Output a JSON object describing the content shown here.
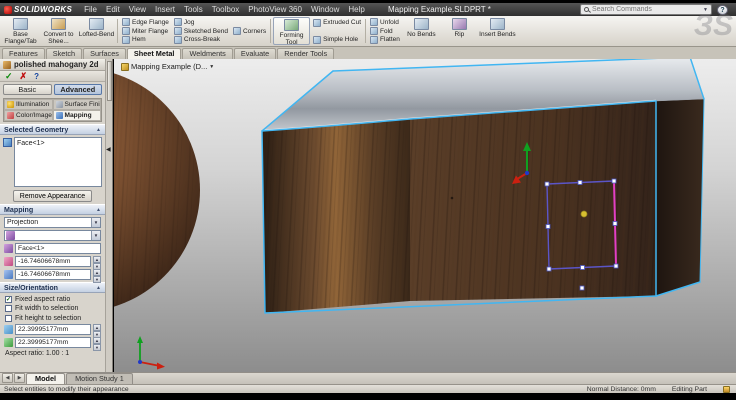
{
  "titlebar": {
    "logo_text": "SOLIDWORKS",
    "menus": [
      "File",
      "Edit",
      "View",
      "Insert",
      "Tools",
      "Toolbox",
      "PhotoView 360",
      "Window",
      "Help"
    ],
    "doc_title": "Mapping Example.SLDPRT *",
    "search_placeholder": "Search Commands"
  },
  "toolbar": {
    "large1": [
      "Base Flange/Tab",
      "Convert to Shee...",
      "Lofted-Bend"
    ],
    "col1": [
      "Edge Flange",
      "Miter Flange",
      "Hem"
    ],
    "col2": [
      "Jog",
      "Sketched Bend",
      "Cross-Break"
    ],
    "corners": "Corners",
    "forming_tool": "Forming Tool",
    "col3": [
      "Extruded Cut",
      "Simple Hole"
    ],
    "col4": [
      "Unfold",
      "Fold",
      "Flatten"
    ],
    "large2": [
      "No Bends",
      "Rip",
      "Insert Bends"
    ]
  },
  "ribbon": {
    "tabs": [
      "Features",
      "Sketch",
      "Surfaces",
      "Sheet Metal",
      "Weldments",
      "Evaluate",
      "Render Tools"
    ]
  },
  "panel": {
    "title": "polished mahogany 2d",
    "modes": [
      "Basic",
      "Advanced"
    ],
    "tabs": [
      "Illumination",
      "Surface Finish",
      "Color/Image",
      "Mapping"
    ],
    "selected_geometry": {
      "header": "Selected Geometry",
      "items": [
        "Face<1>"
      ],
      "remove_button": "Remove Appearance"
    },
    "mapping": {
      "header": "Mapping",
      "projection_type": "Projection",
      "reference": "Face<1>",
      "offset_x": "-16.74606678mm",
      "offset_y": "-16.74606678mm"
    },
    "size_orientation": {
      "header": "Size/Orientation",
      "fixed_aspect": "Fixed aspect ratio",
      "fit_width": "Fit width to selection",
      "fit_height": "Fit height to selection",
      "width": "22.39995177mm",
      "height": "22.39995177mm",
      "aspect": "Aspect ratio: 1.00 : 1"
    }
  },
  "viewport": {
    "tree_label": "Mapping Example (D..."
  },
  "bottom_tabs": {
    "tabs": [
      "Model",
      "Motion Study 1"
    ]
  },
  "statusbar": {
    "hint": "Select entities to modify their appearance",
    "normal_distance": "Normal Distance: 0mm",
    "mode": "Editing Part"
  },
  "icons": {
    "check": "✓",
    "cancel": "✗",
    "help": "?",
    "down": "▼",
    "up": "▲",
    "left": "◀",
    "right": "▶",
    "watermark": "ЗS"
  },
  "colors": {
    "edge_highlight": "#41b6f2",
    "selection_outline": "#5b55c8",
    "selection_active_edge": "#e33fc4",
    "triad_x": "#cc2010",
    "triad_y": "#10a020",
    "wood_base": "#4a3320",
    "metal_top": "#b9bec5"
  }
}
